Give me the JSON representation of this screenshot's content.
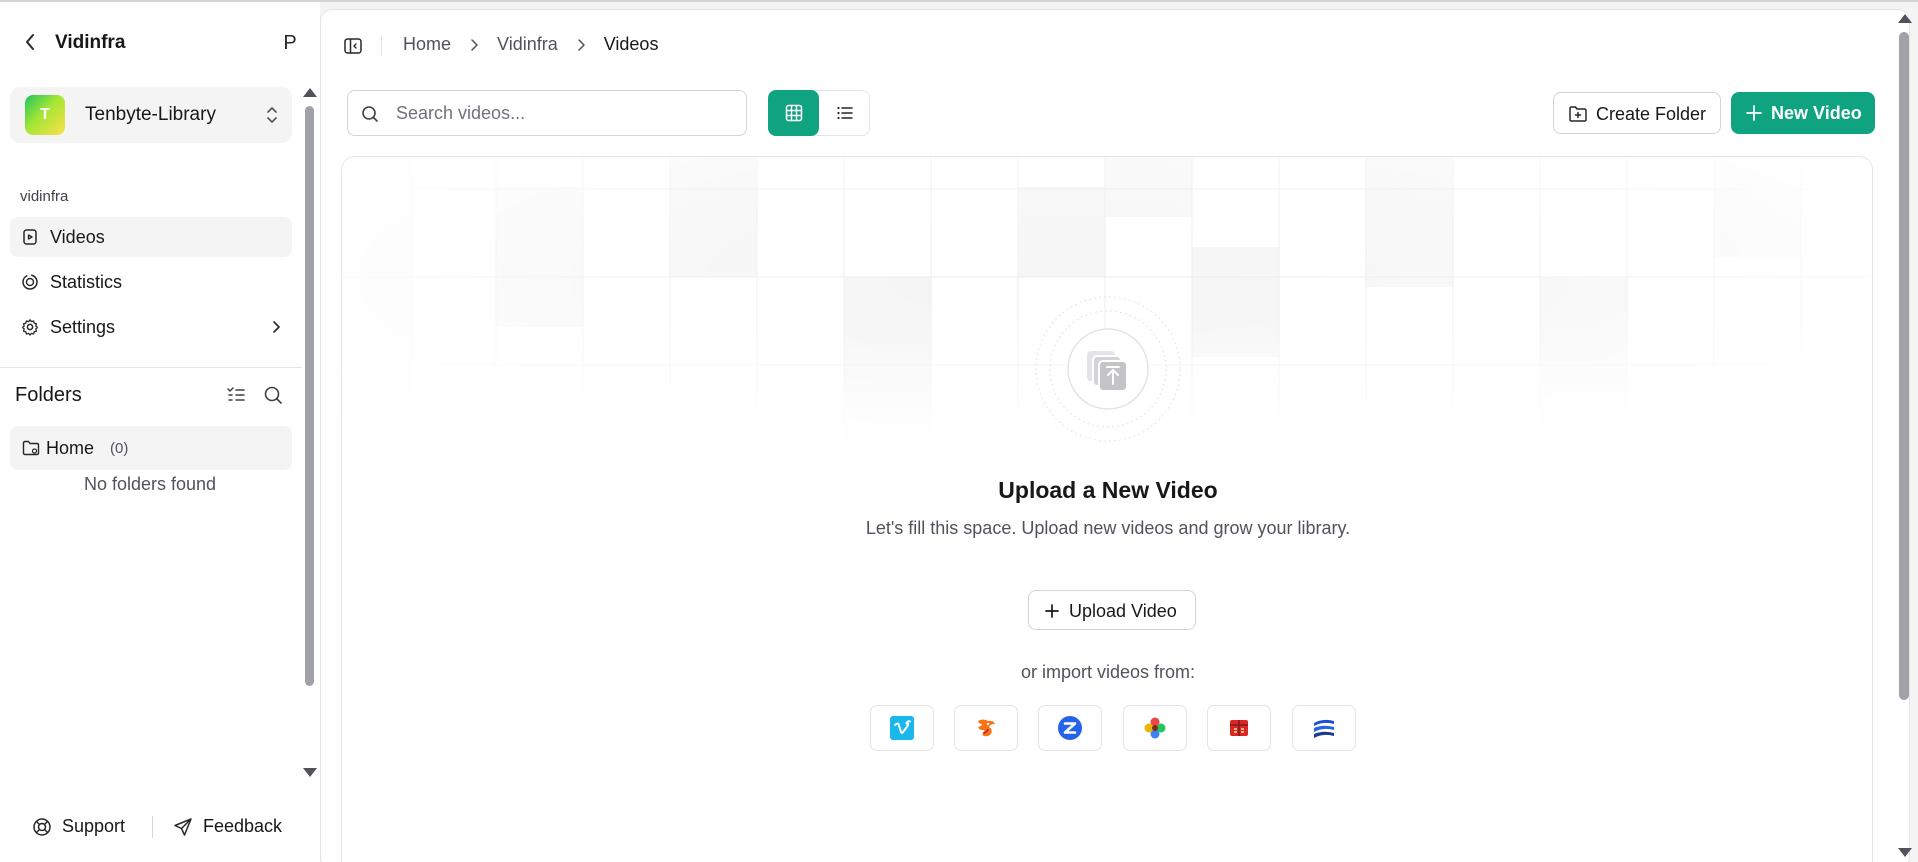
{
  "sidebar": {
    "title": "Vidinfra",
    "user_initial": "P",
    "library": {
      "logo_letter": "T",
      "name": "Tenbyte-Library"
    },
    "section_label": "vidinfra",
    "nav": [
      {
        "label": "Videos",
        "icon": "video-file-icon",
        "active": true
      },
      {
        "label": "Statistics",
        "icon": "chart-ring-icon",
        "active": false
      },
      {
        "label": "Settings",
        "icon": "gear-icon",
        "active": false
      }
    ],
    "folders": {
      "title": "Folders",
      "home_label": "Home",
      "home_count": "(0)",
      "empty_text": "No folders found"
    },
    "footer": {
      "support_label": "Support",
      "feedback_label": "Feedback"
    }
  },
  "main": {
    "breadcrumb": [
      "Home",
      "Vidinfra",
      "Videos"
    ],
    "search": {
      "placeholder": "Search videos...",
      "value": ""
    },
    "view_mode": "grid",
    "create_folder_label": "Create Folder",
    "new_video_label": "New Video",
    "empty_state": {
      "title": "Upload a New Video",
      "description": "Let's fill this space. Upload new videos and grow your library.",
      "upload_label": "Upload Video",
      "import_label": "or import videos from:",
      "import_sources": [
        {
          "icon": "vimeo-icon",
          "color": "#1ab7ea"
        },
        {
          "icon": "dragon-icon",
          "color": "#f97316"
        },
        {
          "icon": "zoom-icon",
          "color": "#2563eb"
        },
        {
          "icon": "flower-icon",
          "color": "#eab308"
        },
        {
          "icon": "box-icon",
          "color": "#dc2626"
        },
        {
          "icon": "wave-icon",
          "color": "#1d4ed8"
        }
      ]
    }
  },
  "colors": {
    "accent": "#10a37f",
    "text": "#18181b",
    "muted": "#52525b",
    "border": "#e4e4e7"
  }
}
